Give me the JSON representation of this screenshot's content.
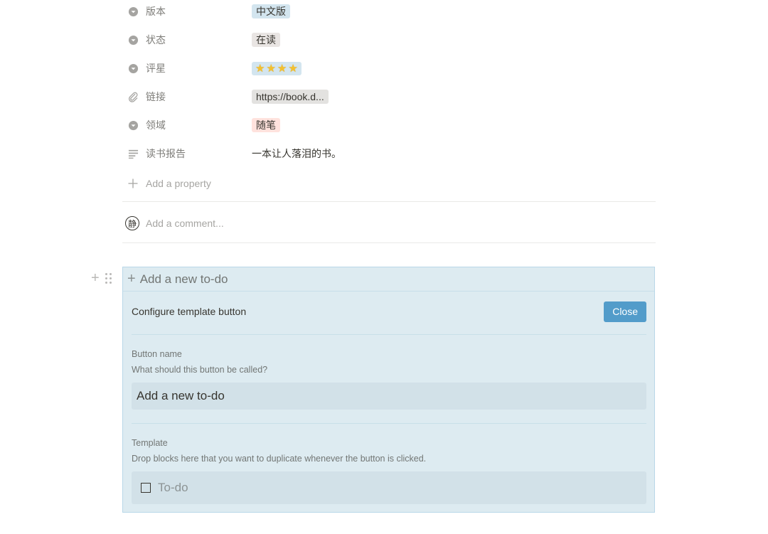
{
  "properties": [
    {
      "icon": "select-icon",
      "name": "版本",
      "type": "tag",
      "value": "中文版",
      "color": "#d3e5ef"
    },
    {
      "icon": "select-icon",
      "name": "状态",
      "type": "tag",
      "value": "在读",
      "color": "#e9e5e3"
    },
    {
      "icon": "select-icon",
      "name": "评星",
      "type": "stars",
      "value": 4,
      "color": "#d3e5ef"
    },
    {
      "icon": "link-icon",
      "name": "链接",
      "type": "tag",
      "value": "https://book.d...",
      "color": "#e3e2e0"
    },
    {
      "icon": "select-icon",
      "name": "领域",
      "type": "tag",
      "value": "随笔",
      "color": "#ffe2dd"
    },
    {
      "icon": "text-icon",
      "name": "读书报告",
      "type": "text",
      "value": "一本让人落泪的书。"
    }
  ],
  "add_property_label": "Add a property",
  "comment": {
    "avatar_char": "静",
    "placeholder": "Add a comment..."
  },
  "template_button": {
    "label": "Add a new to-do",
    "config_title": "Configure template button",
    "close_label": "Close",
    "close_color": "#529cca",
    "button_name_label": "Button name",
    "button_name_help": "What should this button be called?",
    "button_name_value": "Add a new to-do",
    "template_label": "Template",
    "template_help": "Drop blocks here that you want to duplicate whenever the button is clicked.",
    "todo_placeholder": "To-do"
  }
}
